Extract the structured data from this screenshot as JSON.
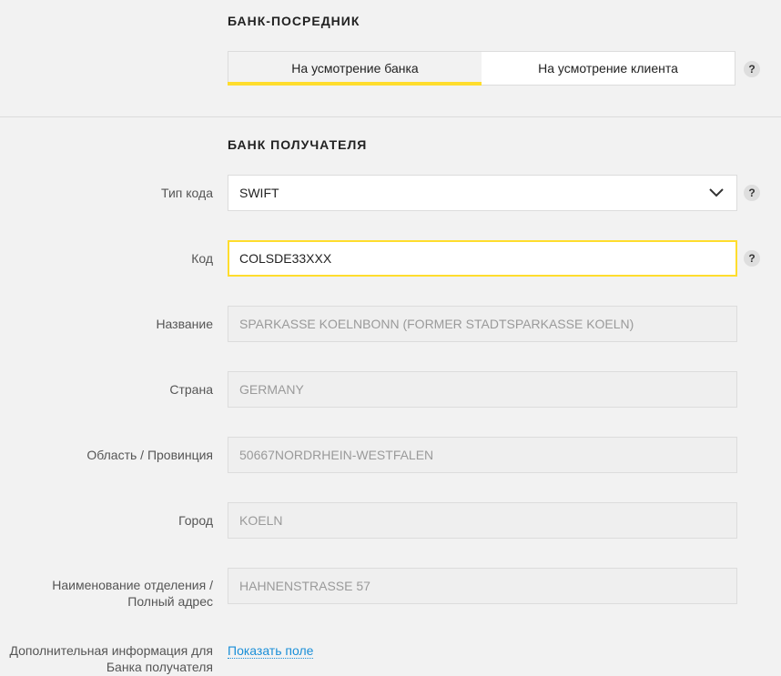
{
  "intermediary_bank": {
    "title": "БАНК-ПОСРЕДНИК",
    "options": [
      "На усмотрение банка",
      "На усмотрение клиента"
    ],
    "selected_index": 0
  },
  "recipient_bank": {
    "title": "БАНК ПОЛУЧАТЕЛЯ",
    "code_type": {
      "label": "Тип кода",
      "value": "SWIFT"
    },
    "code": {
      "label": "Код",
      "value": "COLSDE33XXX"
    },
    "name": {
      "label": "Название",
      "value": "SPARKASSE KOELNBONN (FORMER STADTSPARKASSE KOELN)"
    },
    "country": {
      "label": "Страна",
      "value": "GERMANY"
    },
    "region": {
      "label": "Область / Провинция",
      "value": "50667NORDRHEIN-WESTFALEN"
    },
    "city": {
      "label": "Город",
      "value": "KOELN"
    },
    "branch": {
      "label_line1": "Наименование отделения /",
      "label_line2": "Полный адрес",
      "value": "HAHNENSTRASSE 57"
    },
    "additional": {
      "label_line1": "Дополнительная информация для",
      "label_line2": "Банка получателя",
      "link": "Показать поле"
    }
  },
  "help_symbol": "?",
  "colors": {
    "accent": "#ffdd2d",
    "link": "#1a8fd8"
  }
}
